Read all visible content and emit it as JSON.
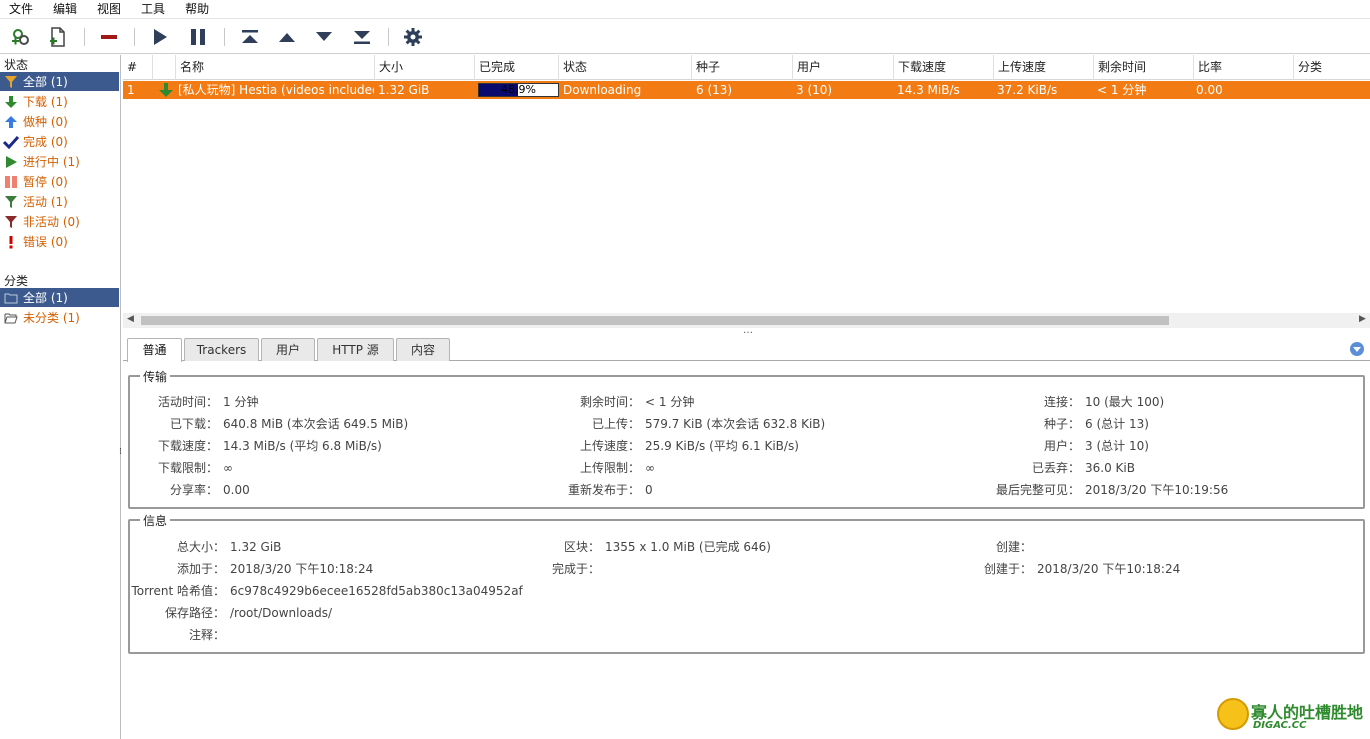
{
  "menu": [
    "文件",
    "编辑",
    "视图",
    "工具",
    "帮助"
  ],
  "toolbar": {
    "icons": [
      "add-link-icon",
      "add-file-icon",
      "remove-icon",
      "resume-icon",
      "pause-icon",
      "move-top-icon",
      "move-up-icon",
      "move-down-icon",
      "move-bottom-icon",
      "settings-icon"
    ]
  },
  "sidebar": {
    "status_header": "状态",
    "status_items": [
      {
        "label": "全部 (1)",
        "icon": "filter-all-icon",
        "color": "#e6a22a"
      },
      {
        "label": "下载 (1)",
        "icon": "download-arrow-icon",
        "color": "#2f8a2f"
      },
      {
        "label": "做种 (0)",
        "icon": "upload-arrow-icon",
        "color": "#3a7be0"
      },
      {
        "label": "完成 (0)",
        "icon": "checkmark-icon",
        "color": "#1a2a8a"
      },
      {
        "label": "进行中 (1)",
        "icon": "play-icon",
        "color": "#2f8a2f"
      },
      {
        "label": "暂停 (0)",
        "icon": "pause-icon",
        "color": "#f08070"
      },
      {
        "label": "活动 (1)",
        "icon": "filter-active-icon",
        "color": "#3d7a3d"
      },
      {
        "label": "非活动 (0)",
        "icon": "filter-inactive-icon",
        "color": "#8a2a2a"
      },
      {
        "label": "错误 (0)",
        "icon": "error-icon",
        "color": "#d00000"
      }
    ],
    "category_header": "分类",
    "category_items": [
      {
        "label": "全部 (1)",
        "icon": "folder-all-icon"
      },
      {
        "label": "未分类 (1)",
        "icon": "folder-open-icon"
      }
    ]
  },
  "table": {
    "columns": [
      "#",
      "",
      "名称",
      "大小",
      "已完成",
      "状态",
      "种子",
      "用户",
      "下载速度",
      "上传速度",
      "剩余时间",
      "比率",
      "分类"
    ],
    "rows": [
      {
        "index": "1",
        "name": "[私人玩物] Hestia (videos included)",
        "size": "1.32 GiB",
        "progress_text": "48.9%",
        "progress": 0.489,
        "status": "Downloading",
        "seeds": "6 (13)",
        "peers": "3 (10)",
        "dl_speed": "14.3 MiB/s",
        "ul_speed": "37.2 KiB/s",
        "eta": "< 1 分钟",
        "ratio": "0.00",
        "category": ""
      }
    ]
  },
  "tabs": [
    "普通",
    "Trackers",
    "用户",
    "HTTP 源",
    "内容"
  ],
  "transfer": {
    "legend": "传输",
    "fields": {
      "active_time": {
        "k": "活动时间：",
        "v": "1 分钟"
      },
      "remaining": {
        "k": "剩余时间：",
        "v": "< 1 分钟"
      },
      "connections": {
        "k": "连接：",
        "v": "10 (最大 100)"
      },
      "downloaded": {
        "k": "已下载：",
        "v": "640.8 MiB (本次会话 649.5 MiB)"
      },
      "uploaded": {
        "k": "已上传：",
        "v": "579.7 KiB (本次会话 632.8 KiB)"
      },
      "seeds": {
        "k": "种子：",
        "v": "6 (总计 13)"
      },
      "dl_speed": {
        "k": "下载速度：",
        "v": "14.3 MiB/s (平均 6.8 MiB/s)"
      },
      "ul_speed": {
        "k": "上传速度：",
        "v": "25.9 KiB/s (平均 6.1 KiB/s)"
      },
      "peers": {
        "k": "用户：",
        "v": "3 (总计 10)"
      },
      "dl_limit": {
        "k": "下载限制：",
        "v": "∞"
      },
      "ul_limit": {
        "k": "上传限制：",
        "v": "∞"
      },
      "wasted": {
        "k": "已丢弃：",
        "v": "36.0 KiB"
      },
      "share_ratio": {
        "k": "分享率：",
        "v": "0.00"
      },
      "reannounce": {
        "k": "重新发布于：",
        "v": "0"
      },
      "last_seen": {
        "k": "最后完整可见：",
        "v": "2018/3/20 下午10:19:56"
      }
    }
  },
  "info": {
    "legend": "信息",
    "fields": {
      "total_size": {
        "k": "总大小：",
        "v": "1.32 GiB"
      },
      "pieces": {
        "k": "区块：",
        "v": "1355 x 1.0 MiB (已完成 646)"
      },
      "created_by": {
        "k": "创建：",
        "v": ""
      },
      "added_on": {
        "k": "添加于：",
        "v": "2018/3/20 下午10:18:24"
      },
      "completed_on": {
        "k": "完成于：",
        "v": ""
      },
      "created_on": {
        "k": "创建于：",
        "v": "2018/3/20 下午10:18:24"
      },
      "hash": {
        "k": "Torrent 哈希值：",
        "v": "6c978c4929b6ecee16528fd5ab380c13a04952af"
      },
      "save_path": {
        "k": "保存路径：",
        "v": "/root/Downloads/"
      },
      "comment": {
        "k": "注释：",
        "v": ""
      }
    }
  },
  "watermark": {
    "title": "寡人的吐槽胜地",
    "sub": "DIGAC.CC"
  }
}
